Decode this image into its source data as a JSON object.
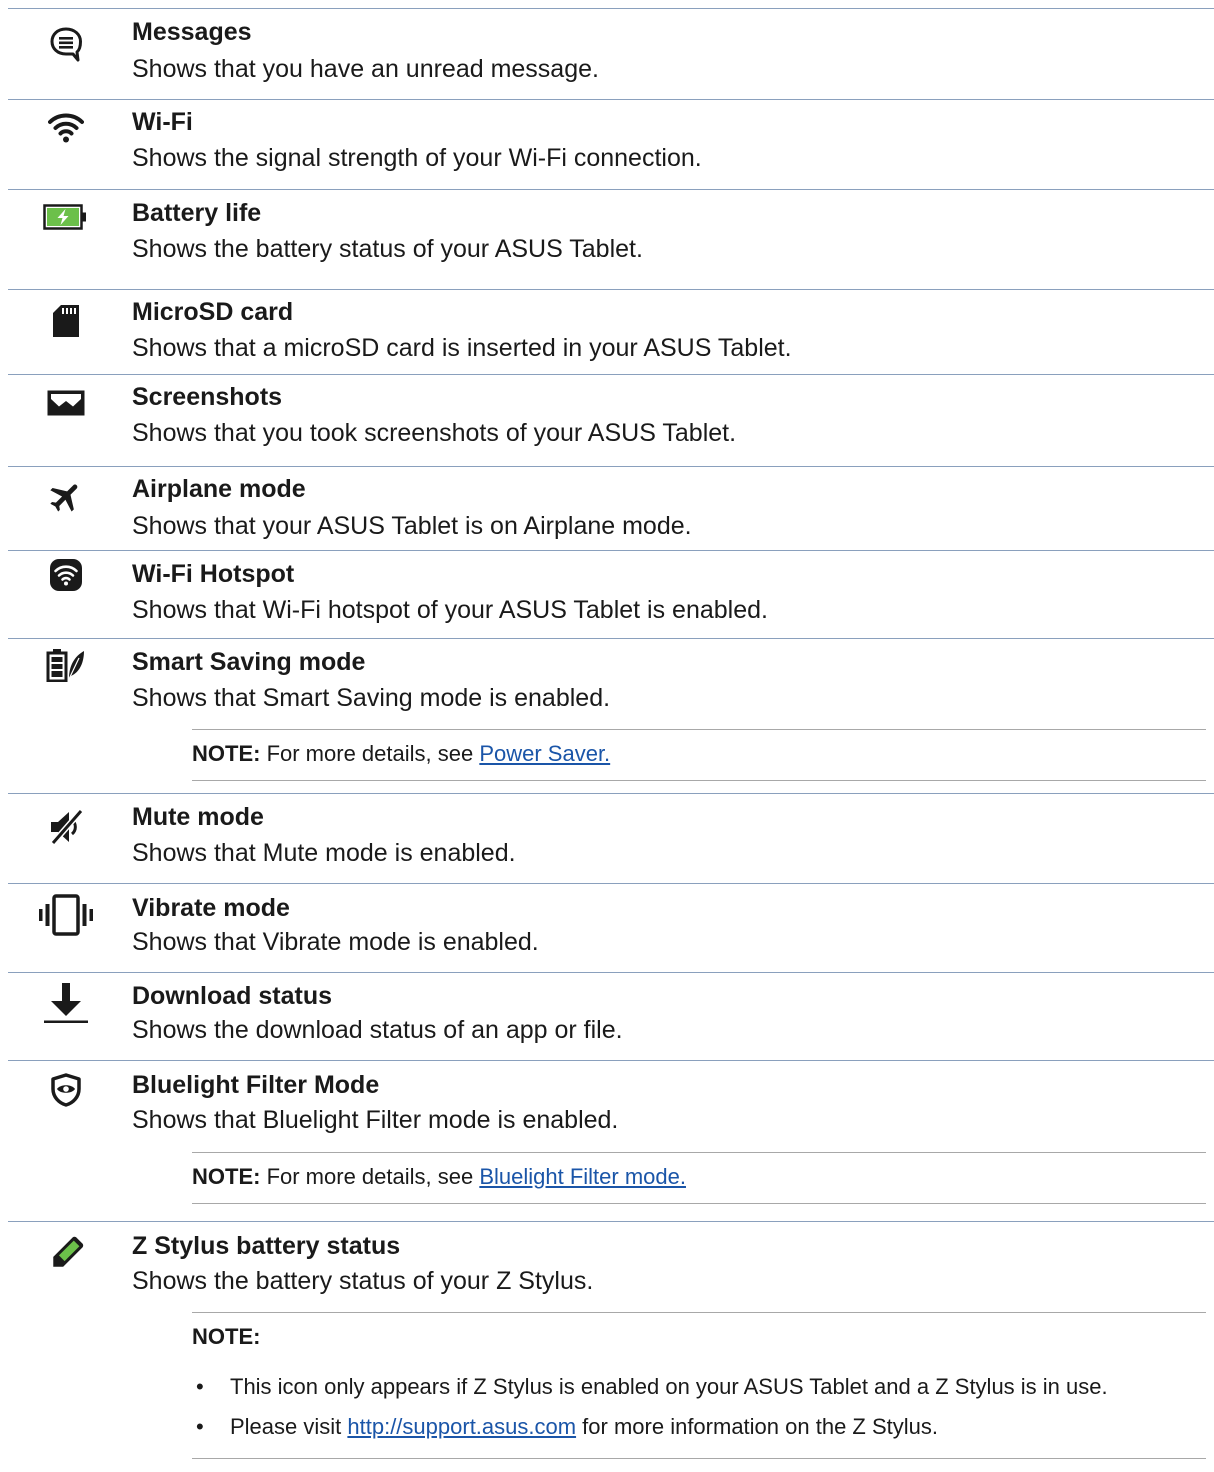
{
  "items": [
    {
      "title": "Messages",
      "desc": "Shows that you have an unread message.",
      "icon": "messages-icon"
    },
    {
      "title": "Wi-Fi",
      "desc": "Shows the signal strength of your Wi-Fi connection.",
      "icon": "wifi-icon"
    },
    {
      "title": "Battery life",
      "desc": "Shows the battery status of your ASUS Tablet.",
      "icon": "battery-icon"
    },
    {
      "title": "MicroSD card",
      "desc": "Shows that a microSD card is inserted in your ASUS Tablet.",
      "icon": "microsd-card-icon"
    },
    {
      "title": "Screenshots",
      "desc": "Shows that you took screenshots of your ASUS Tablet.",
      "icon": "screenshot-icon"
    },
    {
      "title": "Airplane mode",
      "desc": "Shows that your ASUS Tablet is on Airplane mode.",
      "icon": "airplane-icon"
    },
    {
      "title": "Wi-Fi Hotspot",
      "desc": "Shows that Wi-Fi hotspot of your ASUS Tablet is enabled.",
      "icon": "wifi-hotspot-icon"
    },
    {
      "title": "Smart Saving mode",
      "desc": "Shows that Smart Saving mode is enabled.",
      "icon": "smart-saving-icon"
    },
    {
      "title": "Mute mode",
      "desc": "Shows that Mute mode is enabled.",
      "icon": "mute-icon"
    },
    {
      "title": "Vibrate mode",
      "desc": "Shows that Vibrate mode is enabled.",
      "icon": "vibrate-icon"
    },
    {
      "title": "Download status",
      "desc": "Shows the download status of an app or file.",
      "icon": "download-icon"
    },
    {
      "title": "Bluelight Filter Mode",
      "desc": "Shows that Bluelight Filter mode is enabled.",
      "icon": "bluelight-filter-icon"
    },
    {
      "title": "Z Stylus battery status",
      "desc": "Shows the battery status of your Z Stylus.",
      "icon": "stylus-icon"
    }
  ],
  "notes": {
    "smart_saving": {
      "label": "NOTE:",
      "text": " For more details, see ",
      "link": "Power Saver."
    },
    "bluelight": {
      "label": "NOTE:",
      "text": " For more details, see ",
      "link": "Bluelight Filter mode."
    },
    "stylus": {
      "label": "NOTE:",
      "bullet_glyph": "•",
      "bullet1": "This icon only appears if Z Stylus is enabled on your ASUS Tablet and a Z Stylus is in use.",
      "bullet2_pre": "Please visit ",
      "bullet2_link": "http://support.asus.com",
      "bullet2_post": " for more information on the Z Stylus."
    }
  },
  "colors": {
    "rule": "#8aa0bd",
    "link": "#1a55a8",
    "battery_fill": "#6cc04a"
  }
}
